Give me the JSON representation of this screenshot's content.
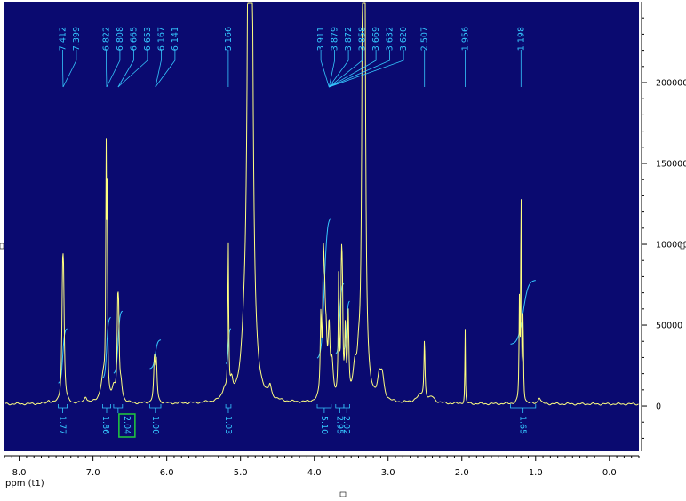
{
  "chart_data": {
    "type": "line",
    "xlabel": "ppm (t1)",
    "x_ticks": [
      "8.0",
      "7.0",
      "6.0",
      "5.0",
      "4.0",
      "3.0",
      "2.0",
      "1.0",
      "0.0"
    ],
    "y_ticks": [
      "200000",
      "150000",
      "100000",
      "50000",
      "0"
    ],
    "xlim": [
      8.2,
      -0.4
    ],
    "ylim": [
      -28000,
      250000
    ],
    "colors": {
      "background": "#0a0a70",
      "spectrum": "#ffff80",
      "integral": "#35c8ff",
      "label": "#35c8ff",
      "axis": "#000000",
      "highlight_box": "#20c040"
    },
    "peaks": [
      {
        "label": "7.412",
        "ppm": 7.412,
        "height": 62000,
        "width": 0.012
      },
      {
        "label": "7.399",
        "ppm": 7.399,
        "height": 58000,
        "width": 0.012
      },
      {
        "label": "6.822",
        "ppm": 6.822,
        "height": 140000,
        "width": 0.006
      },
      {
        "label": "6.808",
        "ppm": 6.808,
        "height": 110000,
        "width": 0.006
      },
      {
        "label": "6.665",
        "ppm": 6.665,
        "height": 45000,
        "width": 0.01
      },
      {
        "label": "6.653",
        "ppm": 6.653,
        "height": 42000,
        "width": 0.01
      },
      {
        "label": "6.167",
        "ppm": 6.167,
        "height": 26000,
        "width": 0.012
      },
      {
        "label": "6.141",
        "ppm": 6.141,
        "height": 24000,
        "width": 0.012
      },
      {
        "label": "5.166",
        "ppm": 5.166,
        "height": 95000,
        "width": 0.007
      },
      {
        "label": "3.911",
        "ppm": 3.911,
        "height": 48000,
        "width": 0.01
      },
      {
        "label": "3.879",
        "ppm": 3.879,
        "height": 45000,
        "width": 0.01
      },
      {
        "label": "3.872",
        "ppm": 3.872,
        "height": 44000,
        "width": 0.01
      },
      {
        "label": "3.858",
        "ppm": 3.858,
        "height": 36000,
        "width": 0.01
      },
      {
        "label": "3.669",
        "ppm": 3.669,
        "height": 78000,
        "width": 0.008
      },
      {
        "label": "3.632",
        "ppm": 3.632,
        "height": 72000,
        "width": 0.008
      },
      {
        "label": "3.620",
        "ppm": 3.62,
        "height": 60000,
        "width": 0.008
      },
      {
        "label": "2.507",
        "ppm": 2.507,
        "height": 36000,
        "width": 0.008
      },
      {
        "label": "1.956",
        "ppm": 1.956,
        "height": 50000,
        "width": 0.004
      },
      {
        "label": "1.198",
        "ppm": 1.198,
        "height": 140000,
        "width": 0.005
      }
    ],
    "unlabeled_peaks": [
      {
        "ppm": 4.87,
        "height": 1000000,
        "width": 0.02
      },
      {
        "ppm": 3.33,
        "height": 1000000,
        "width": 0.012
      },
      {
        "ppm": 6.86,
        "height": 16000,
        "width": 0.04
      },
      {
        "ppm": 6.72,
        "height": 8000,
        "width": 0.03
      },
      {
        "ppm": 6.62,
        "height": 10000,
        "width": 0.02
      },
      {
        "ppm": 5.22,
        "height": 6000,
        "width": 0.03
      },
      {
        "ppm": 5.12,
        "height": 8000,
        "width": 0.02
      },
      {
        "ppm": 4.95,
        "height": 18000,
        "width": 0.04
      },
      {
        "ppm": 4.6,
        "height": 7000,
        "width": 0.02
      },
      {
        "ppm": 3.84,
        "height": 32000,
        "width": 0.015
      },
      {
        "ppm": 3.8,
        "height": 40000,
        "width": 0.015
      },
      {
        "ppm": 3.76,
        "height": 20000,
        "width": 0.02
      },
      {
        "ppm": 3.58,
        "height": 40000,
        "width": 0.01
      },
      {
        "ppm": 3.54,
        "height": 50000,
        "width": 0.01
      },
      {
        "ppm": 3.45,
        "height": 16000,
        "width": 0.03
      },
      {
        "ppm": 3.4,
        "height": 12000,
        "width": 0.02
      },
      {
        "ppm": 3.12,
        "height": 12000,
        "width": 0.03
      },
      {
        "ppm": 3.08,
        "height": 14000,
        "width": 0.03
      },
      {
        "ppm": 2.55,
        "height": 5000,
        "width": 0.08
      },
      {
        "ppm": 2.4,
        "height": 3000,
        "width": 0.04
      },
      {
        "ppm": 1.22,
        "height": 60000,
        "width": 0.006
      },
      {
        "ppm": 1.17,
        "height": 55000,
        "width": 0.006
      },
      {
        "ppm": 0.95,
        "height": 4000,
        "width": 0.02
      },
      {
        "ppm": 7.1,
        "height": 4000,
        "width": 0.02
      },
      {
        "ppm": 7.6,
        "height": 2000,
        "width": 0.02
      }
    ],
    "label_groups": [
      {
        "labels": [
          "7.412",
          "7.399"
        ],
        "target_ppm": 7.405
      },
      {
        "labels": [
          "6.822",
          "6.808"
        ],
        "target_ppm": 6.815
      },
      {
        "labels": [
          "6.665",
          "6.653"
        ],
        "target_ppm": 6.66
      },
      {
        "labels": [
          "6.167",
          "6.141"
        ],
        "target_ppm": 6.154
      },
      {
        "labels": [
          "5.166"
        ],
        "target_ppm": 5.166
      },
      {
        "labels": [
          "3.911",
          "3.879",
          "3.872",
          "3.858",
          "3.669",
          "3.632",
          "3.620"
        ],
        "target_ppm": 3.8
      },
      {
        "labels": [
          "2.507"
        ],
        "target_ppm": 2.507
      },
      {
        "labels": [
          "1.956"
        ],
        "target_ppm": 1.956
      },
      {
        "labels": [
          "1.198"
        ],
        "target_ppm": 1.198
      }
    ],
    "integrals": [
      {
        "value": "1.77",
        "from": 7.47,
        "to": 7.35,
        "rise": 34000
      },
      {
        "value": "1.86",
        "from": 6.87,
        "to": 6.76,
        "rise": 38000
      },
      {
        "value": "2.04",
        "from": 6.72,
        "to": 6.6,
        "rise": 39000,
        "highlighted": true
      },
      {
        "value": "1.00",
        "from": 6.23,
        "to": 6.08,
        "rise": 18000
      },
      {
        "value": "1.03",
        "from": 5.2,
        "to": 5.13,
        "rise": 22000
      },
      {
        "value": "5.10",
        "from": 3.96,
        "to": 3.77,
        "rise": 88000
      },
      {
        "value": "2.95",
        "from": 3.71,
        "to": 3.6,
        "rise": 44000
      },
      {
        "value": "2.02",
        "from": 3.6,
        "to": 3.52,
        "rise": 30000
      },
      {
        "value": "1.65",
        "from": 1.34,
        "to": 1.0,
        "rise": 40000
      }
    ]
  }
}
